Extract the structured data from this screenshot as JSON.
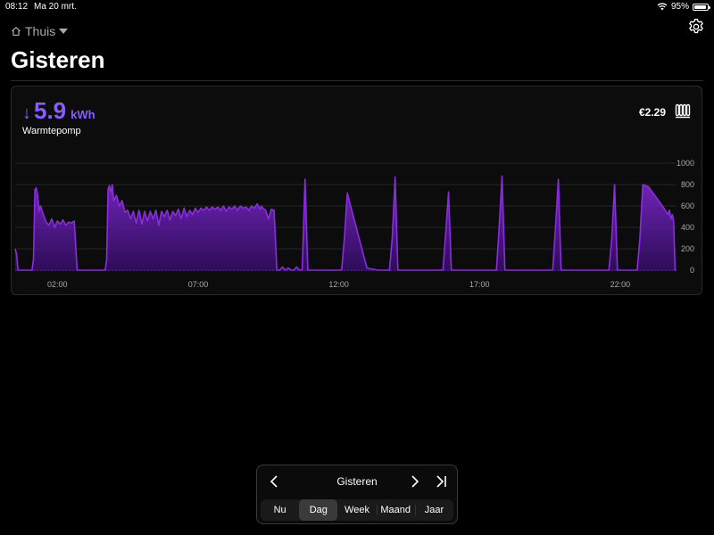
{
  "status_bar": {
    "time": "08:12",
    "date": "Ma 20 mrt.",
    "battery": "95%",
    "battery_level": 0.95
  },
  "header": {
    "home_label": "Thuis",
    "title": "Gisteren"
  },
  "card": {
    "direction_arrow": "↓",
    "value": "5.9",
    "unit": "kWh",
    "device": "Warmtepomp",
    "cost": "€2.29",
    "icon": "radiator-icon",
    "accent_color": "#8a2be2",
    "value_color": "#8a5cff"
  },
  "chart_data": {
    "type": "area",
    "x_unit": "hour",
    "xlim": [
      0.5,
      24
    ],
    "ylim": [
      0,
      1000
    ],
    "x_ticks": [
      2,
      7,
      12,
      17,
      22
    ],
    "x_tick_labels": [
      "02:00",
      "07:00",
      "12:00",
      "17:00",
      "22:00"
    ],
    "y_ticks": [
      0,
      200,
      400,
      600,
      800,
      1000
    ],
    "y_tick_labels": [
      "0",
      "200",
      "400",
      "600",
      "800",
      "1000"
    ],
    "y_axis_side": "right",
    "grid": true,
    "x": [
      0.5,
      0.55,
      0.6,
      0.7,
      0.8,
      0.9,
      1.0,
      1.1,
      1.15,
      1.2,
      1.25,
      1.3,
      1.35,
      1.4,
      1.5,
      1.6,
      1.7,
      1.8,
      1.9,
      2.0,
      2.1,
      2.2,
      2.3,
      2.4,
      2.5,
      2.6,
      2.7,
      2.8,
      2.9,
      3.0,
      3.1,
      3.2,
      3.3,
      3.4,
      3.5,
      3.6,
      3.7,
      3.75,
      3.8,
      3.85,
      3.9,
      3.95,
      4.0,
      4.1,
      4.2,
      4.3,
      4.4,
      4.5,
      4.6,
      4.7,
      4.8,
      4.9,
      5.0,
      5.1,
      5.2,
      5.3,
      5.4,
      5.5,
      5.6,
      5.7,
      5.8,
      5.9,
      6.0,
      6.1,
      6.2,
      6.3,
      6.4,
      6.5,
      6.6,
      6.7,
      6.8,
      6.9,
      7.0,
      7.1,
      7.2,
      7.3,
      7.4,
      7.5,
      7.6,
      7.7,
      7.8,
      7.9,
      8.0,
      8.1,
      8.2,
      8.3,
      8.4,
      8.5,
      8.6,
      8.7,
      8.8,
      8.9,
      9.0,
      9.1,
      9.2,
      9.25,
      9.3,
      9.4,
      9.5,
      9.6,
      9.7,
      9.8,
      9.9,
      10.0,
      10.1,
      10.2,
      10.3,
      10.4,
      10.5,
      10.6,
      10.7,
      10.8,
      10.9,
      11.0,
      11.5,
      11.6,
      11.7,
      11.8,
      11.9,
      12.0,
      12.1,
      12.2,
      12.3,
      13.0,
      13.4,
      13.5,
      13.6,
      13.7,
      13.8,
      13.9,
      14.0,
      14.1,
      14.2,
      15.0,
      15.3,
      15.4,
      15.5,
      15.6,
      15.7,
      15.8,
      15.9,
      16.0,
      16.1,
      17.0,
      17.2,
      17.3,
      17.4,
      17.5,
      17.6,
      17.7,
      17.8,
      17.9,
      18.0,
      19.0,
      19.2,
      19.3,
      19.4,
      19.5,
      19.6,
      19.7,
      19.8,
      19.9,
      20.0,
      21.0,
      21.2,
      21.3,
      21.4,
      21.5,
      21.6,
      21.7,
      21.8,
      21.9,
      22.0,
      22.1,
      22.2,
      22.3,
      22.4,
      22.5,
      22.6,
      22.7,
      22.8,
      23.0,
      23.5,
      23.7,
      23.75,
      23.8,
      23.85,
      23.9,
      23.95,
      24.0
    ],
    "y": [
      200,
      150,
      0,
      0,
      0,
      0,
      0,
      0,
      100,
      750,
      770,
      700,
      550,
      600,
      520,
      450,
      420,
      480,
      400,
      460,
      430,
      470,
      420,
      450,
      440,
      460,
      0,
      0,
      0,
      0,
      0,
      0,
      0,
      0,
      0,
      0,
      0,
      100,
      760,
      790,
      730,
      800,
      650,
      700,
      600,
      650,
      540,
      560,
      480,
      550,
      440,
      560,
      430,
      550,
      460,
      550,
      480,
      560,
      420,
      550,
      500,
      560,
      470,
      550,
      510,
      570,
      480,
      580,
      500,
      560,
      520,
      580,
      540,
      580,
      560,
      590,
      560,
      590,
      570,
      590,
      560,
      600,
      550,
      590,
      570,
      600,
      560,
      600,
      580,
      590,
      560,
      600,
      580,
      620,
      570,
      600,
      580,
      560,
      480,
      570,
      560,
      0,
      0,
      30,
      0,
      20,
      0,
      0,
      30,
      0,
      0,
      850,
      0,
      0,
      0,
      0,
      0,
      0,
      0,
      0,
      0,
      300,
      720,
      20,
      0,
      0,
      0,
      0,
      0,
      300,
      870,
      0,
      0,
      0,
      0,
      0,
      0,
      0,
      0,
      350,
      730,
      0,
      0,
      0,
      0,
      0,
      0,
      0,
      0,
      400,
      880,
      0,
      0,
      0,
      0,
      0,
      0,
      0,
      0,
      400,
      850,
      0,
      0,
      0,
      0,
      0,
      0,
      0,
      0,
      300,
      800,
      0,
      0,
      0,
      0,
      0,
      0,
      0,
      0,
      300,
      800,
      780,
      600,
      520,
      560,
      480,
      520,
      460,
      0,
      0,
      0,
      10,
      720,
      680,
      550,
      600
    ]
  },
  "period_nav": {
    "label": "Gisteren",
    "tabs": [
      "Nu",
      "Dag",
      "Week",
      "Maand",
      "Jaar"
    ],
    "active_index": 1
  }
}
